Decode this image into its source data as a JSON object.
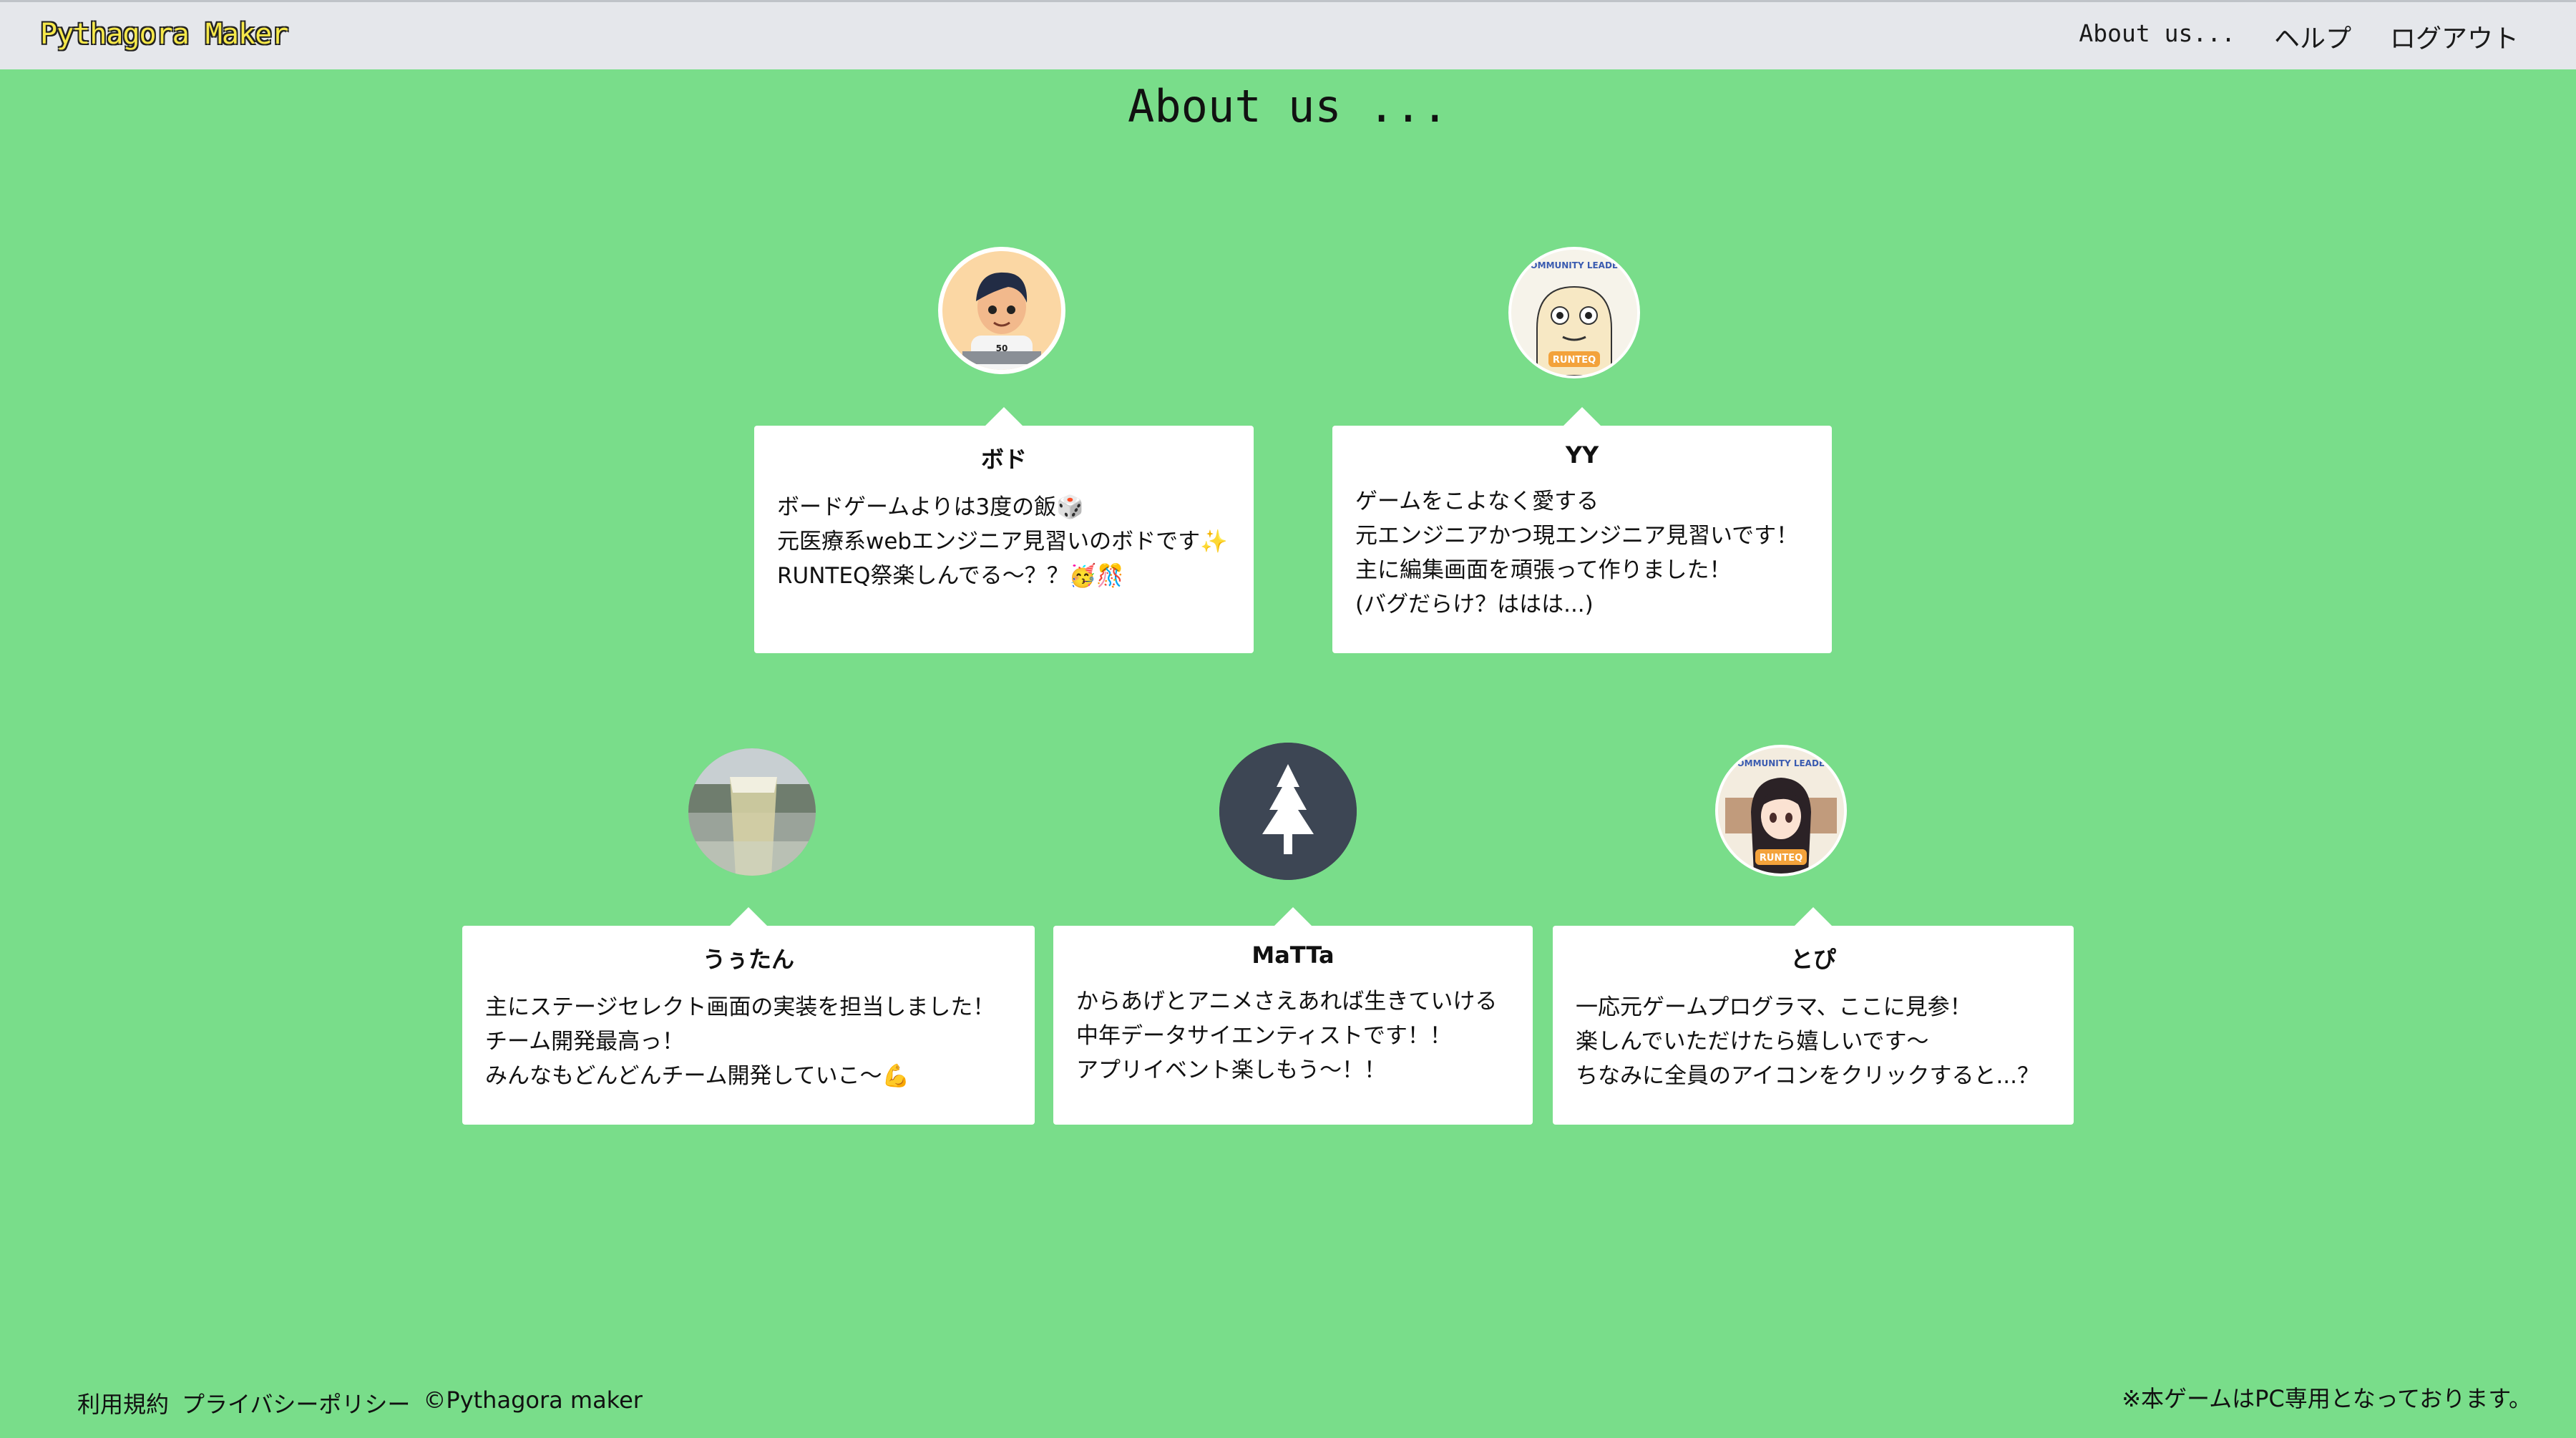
{
  "header": {
    "brand": "Pythagora Maker",
    "nav": [
      "About us...",
      "ヘルプ",
      "ログアウト"
    ]
  },
  "title": "About us ...",
  "members": [
    {
      "name": "ボド",
      "lines": [
        "ボードゲームよりは3度の飯🎲",
        "元医療系webエンジニア見習いのボドです✨",
        "RUNTEQ祭楽しんでる〜？？🥳🎊"
      ]
    },
    {
      "name": "YY",
      "lines": [
        "ゲームをこよなく愛する",
        "元エンジニアかつ現エンジニア見習いです！",
        "主に編集画面を頑張って作りました！",
        "(バグだらけ？ははは...)"
      ]
    },
    {
      "name": "うぅたん",
      "lines": [
        "主にステージセレクト画面の実装を担当しました！",
        "チーム開発最高っ！",
        "みんなもどんどんチーム開発していこ〜💪"
      ]
    },
    {
      "name": "MaTTa",
      "lines": [
        "からあげとアニメさえあれば生きていける",
        "中年データサイエンティストです！！",
        "アプリイベント楽しもう〜！！"
      ]
    },
    {
      "name": "とぴ",
      "lines": [
        "一応元ゲームプログラマ、ここに見参！",
        "楽しんでいただけたら嬉しいです〜",
        "ちなみに全員のアイコンをクリックすると...？"
      ]
    }
  ],
  "avatar_badges": {
    "bodo_shirt": "50",
    "yy_top": "COMMUNITY LEADER",
    "yy_bottom": "RUNTEQ",
    "topi_top": "COMMUNITY LEADER",
    "topi_bottom": "RUNTEQ"
  },
  "footer": {
    "links": [
      "利用規約",
      "プライバシーポリシー",
      "©Pythagora maker"
    ],
    "notice": "※本ゲームはPC専用となっております。"
  },
  "colors": {
    "background": "#79dd8a",
    "navbar": "#e5e7eb",
    "brand": "#f6e84a",
    "card": "#ffffff"
  }
}
